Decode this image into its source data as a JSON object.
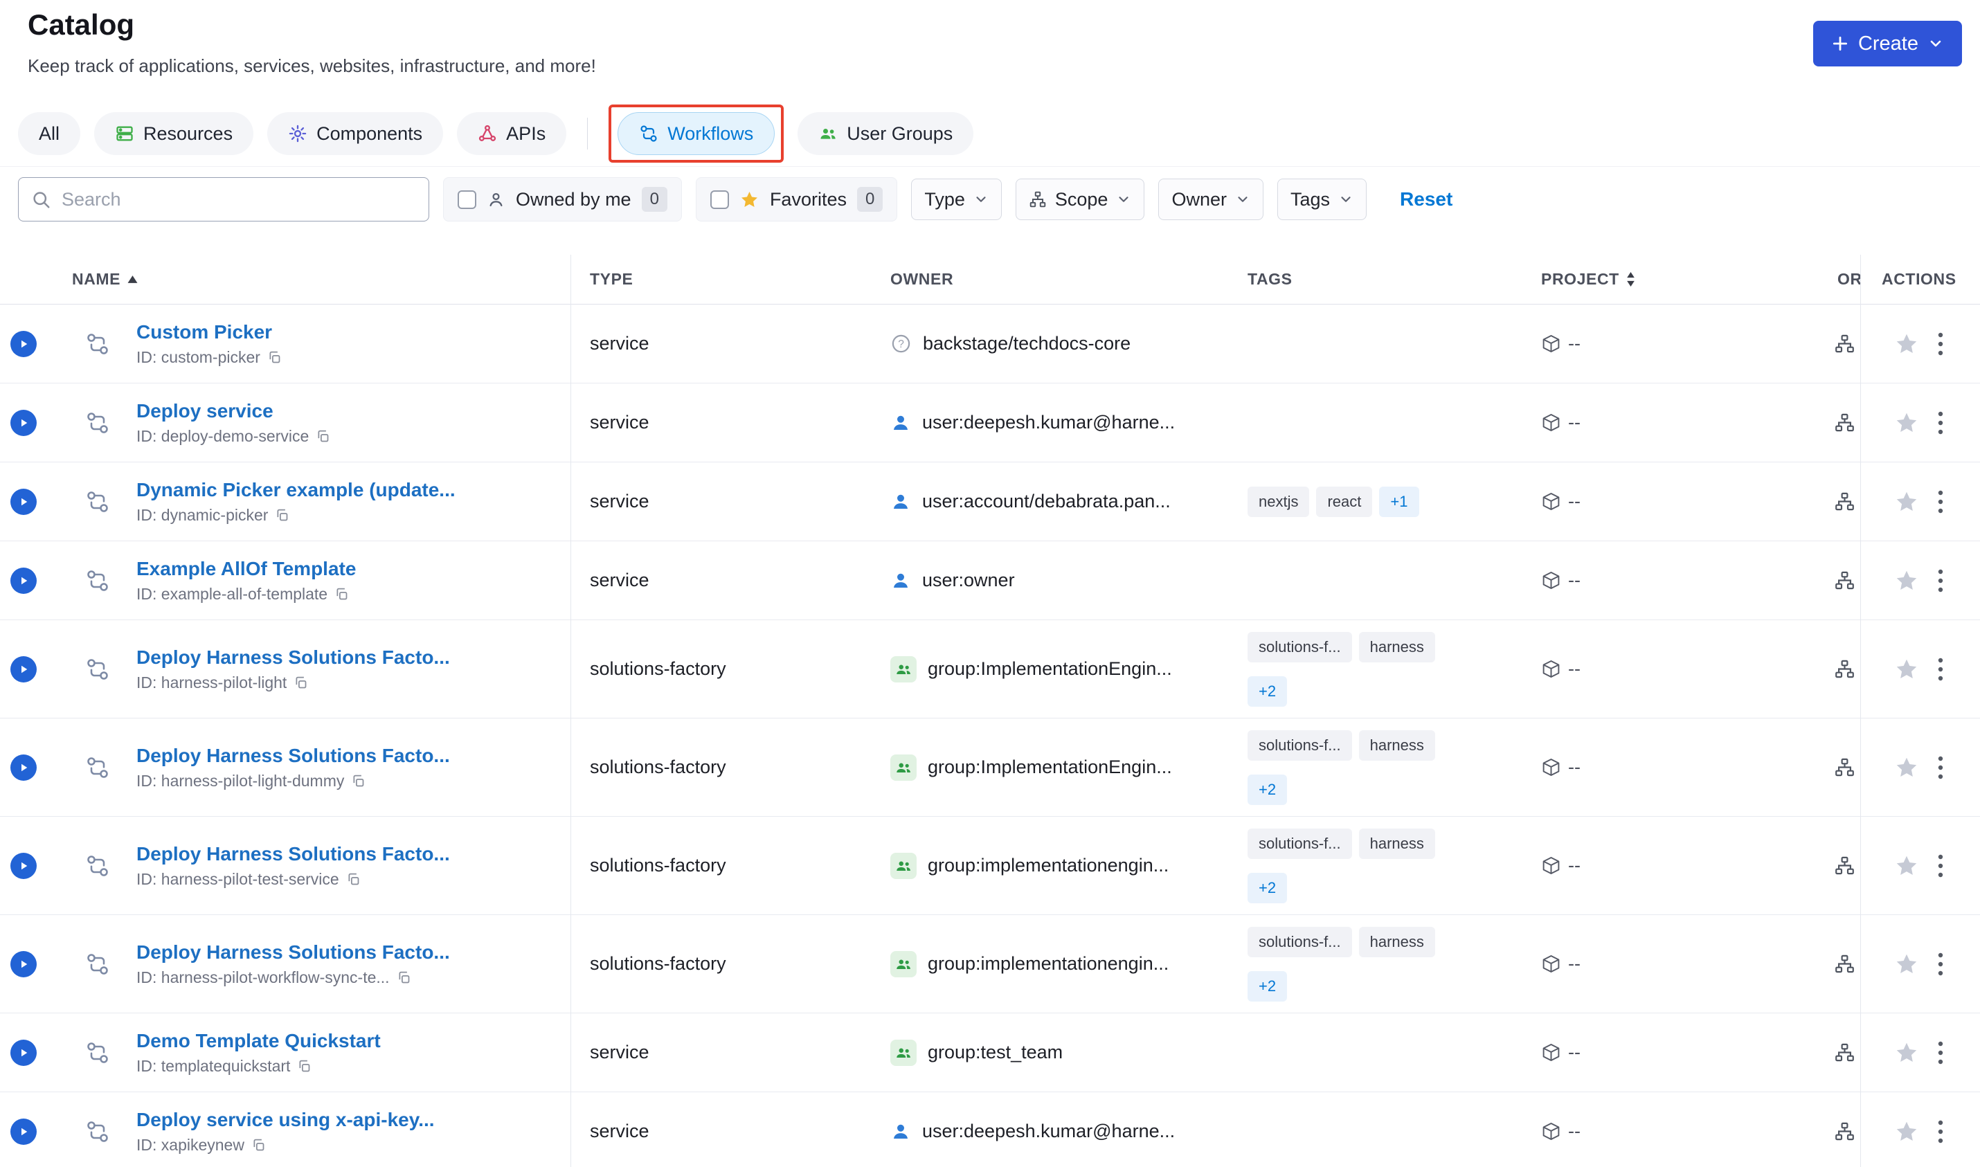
{
  "header": {
    "title": "Catalog",
    "subtitle": "Keep track of applications, services, websites, infrastructure, and more!",
    "create_label": "Create"
  },
  "colors": {
    "create_button": "#2f54d8",
    "link_blue": "#1d6fc2",
    "primary_blue": "#0277d4",
    "annotation_red": "#e8402e",
    "favorites_star": "#f3b831",
    "resources_green": "#3fae49",
    "components_purple": "#5b5fd6",
    "apis_red": "#d6456b"
  },
  "icons": {
    "create_plus": "plus",
    "create_chevron": "chevron-down",
    "search": "magnifier",
    "owned_by_me": "person",
    "favorites": "star",
    "scope": "hierarchy",
    "dropdown_chevron": "chevron-down",
    "row_leading": "workflow",
    "project": "package-cube",
    "org": "sitemap",
    "favorite": "star",
    "menu": "kebab-vertical-dots",
    "copy": "copy",
    "owner_unknown": "circle-question",
    "owner_user": "person",
    "owner_group": "people"
  },
  "tabs": [
    {
      "label": "All"
    },
    {
      "label": "Resources"
    },
    {
      "label": "Components"
    },
    {
      "label": "APIs"
    },
    {
      "label": "Workflows",
      "active": true,
      "annotated": true
    },
    {
      "label": "User Groups"
    }
  ],
  "filters": {
    "search_placeholder": "Search",
    "owned_by_me": {
      "label": "Owned by me",
      "count": "0"
    },
    "favorites": {
      "label": "Favorites",
      "count": "0"
    },
    "type": {
      "label": "Type"
    },
    "scope": {
      "label": "Scope"
    },
    "owner": {
      "label": "Owner"
    },
    "tags": {
      "label": "Tags"
    },
    "reset_label": "Reset"
  },
  "table": {
    "columns": {
      "name": "NAME",
      "type": "TYPE",
      "owner": "OWNER",
      "tags": "TAGS",
      "project": "PROJECT",
      "org": "OR",
      "actions": "ACTIONS"
    },
    "rows": [
      {
        "name": "Custom Picker",
        "id": "ID: custom-picker",
        "type": "service",
        "owner": {
          "icon": "unknown",
          "text": "backstage/techdocs-core"
        },
        "tags": [],
        "tags_more": null,
        "tags_wrap": false,
        "project": "--"
      },
      {
        "name": "Deploy service",
        "id": "ID: deploy-demo-service",
        "type": "service",
        "owner": {
          "icon": "user",
          "text": "user:deepesh.kumar@harne..."
        },
        "tags": [],
        "tags_more": null,
        "tags_wrap": false,
        "project": "--"
      },
      {
        "name": "Dynamic Picker example (update...",
        "id": "ID: dynamic-picker",
        "type": "service",
        "owner": {
          "icon": "user",
          "text": "user:account/debabrata.pan..."
        },
        "tags": [
          "nextjs",
          "react"
        ],
        "tags_more": "+1",
        "tags_wrap": false,
        "project": "--"
      },
      {
        "name": "Example AllOf Template",
        "id": "ID: example-all-of-template",
        "type": "service",
        "owner": {
          "icon": "user",
          "text": "user:owner"
        },
        "tags": [],
        "tags_more": null,
        "tags_wrap": false,
        "project": "--"
      },
      {
        "name": "Deploy Harness Solutions Facto...",
        "id": "ID: harness-pilot-light",
        "type": "solutions-factory",
        "owner": {
          "icon": "group",
          "text": "group:ImplementationEngin..."
        },
        "tags": [
          "solutions-f...",
          "harness"
        ],
        "tags_more": "+2",
        "tags_wrap": true,
        "project": "--"
      },
      {
        "name": "Deploy Harness Solutions Facto...",
        "id": "ID: harness-pilot-light-dummy",
        "type": "solutions-factory",
        "owner": {
          "icon": "group",
          "text": "group:ImplementationEngin..."
        },
        "tags": [
          "solutions-f...",
          "harness"
        ],
        "tags_more": "+2",
        "tags_wrap": true,
        "project": "--"
      },
      {
        "name": "Deploy Harness Solutions Facto...",
        "id": "ID: harness-pilot-test-service",
        "type": "solutions-factory",
        "owner": {
          "icon": "group",
          "text": "group:implementationengin..."
        },
        "tags": [
          "solutions-f...",
          "harness"
        ],
        "tags_more": "+2",
        "tags_wrap": true,
        "project": "--"
      },
      {
        "name": "Deploy Harness Solutions Facto...",
        "id": "ID: harness-pilot-workflow-sync-te...",
        "type": "solutions-factory",
        "owner": {
          "icon": "group",
          "text": "group:implementationengin..."
        },
        "tags": [
          "solutions-f...",
          "harness"
        ],
        "tags_more": "+2",
        "tags_wrap": true,
        "project": "--"
      },
      {
        "name": "Demo Template Quickstart",
        "id": "ID: templatequickstart",
        "type": "service",
        "owner": {
          "icon": "group",
          "text": "group:test_team"
        },
        "tags": [],
        "tags_more": null,
        "tags_wrap": false,
        "project": "--"
      },
      {
        "name": "Deploy service using x-api-key...",
        "id": "ID: xapikeynew",
        "type": "service",
        "owner": {
          "icon": "user",
          "text": "user:deepesh.kumar@harne..."
        },
        "tags": [],
        "tags_more": null,
        "tags_wrap": false,
        "project": "--"
      }
    ]
  }
}
